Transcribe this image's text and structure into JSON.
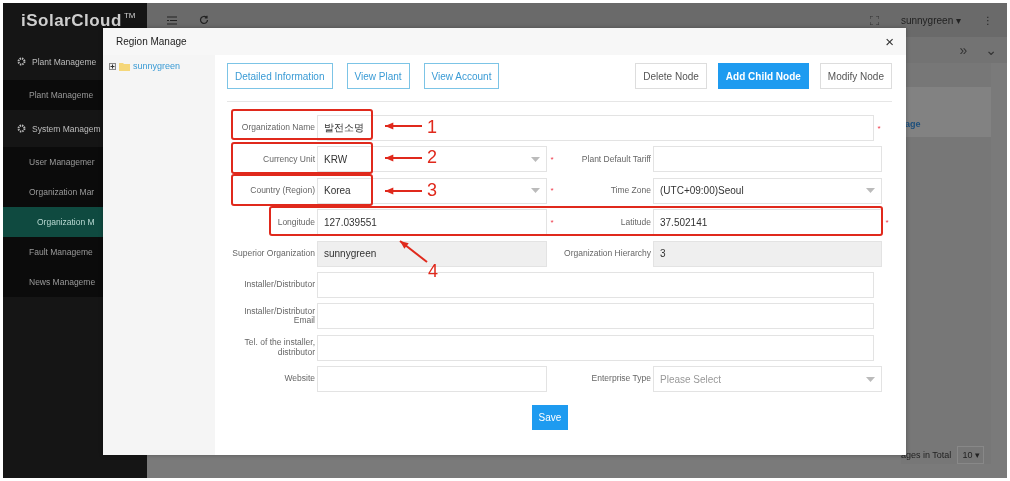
{
  "app": {
    "logo": "iSolarCloud",
    "logo_mark": "TM",
    "user": "sunnygreen ▾",
    "more": "⋮",
    "tabs_more": "»",
    "tabs_menu": "⌄"
  },
  "sidebar": {
    "items": [
      {
        "label": "Plant Manageme",
        "kind": "group",
        "selected": false
      },
      {
        "label": "Plant Manageme",
        "kind": "item",
        "selected": false
      },
      {
        "label": "System Managem",
        "kind": "group",
        "selected": false
      },
      {
        "label": "User Managemer",
        "kind": "item",
        "selected": false
      },
      {
        "label": "Organization Mar",
        "kind": "item",
        "selected": false
      },
      {
        "label": "Organization M",
        "kind": "subitem",
        "selected": true
      },
      {
        "label": "Fault Manageme",
        "kind": "item",
        "selected": false
      },
      {
        "label": "News Manageme",
        "kind": "item",
        "selected": false
      }
    ]
  },
  "background": {
    "link": "age",
    "pager_text": "ages in Total",
    "page_size": "10 ▾"
  },
  "dialog": {
    "title": "Region Manage",
    "close": "×",
    "tree": [
      {
        "label": "sunnygreen",
        "expanded": false
      }
    ],
    "actions_left": [
      {
        "label": "Detailed Information"
      },
      {
        "label": "View Plant"
      },
      {
        "label": "View Account"
      }
    ],
    "actions_right": [
      {
        "label": "Delete Node",
        "primary": false
      },
      {
        "label": "Add Child Node",
        "primary": true
      },
      {
        "label": "Modify Node",
        "primary": false
      }
    ],
    "required_mark": "*",
    "rows": [
      [
        {
          "label": "Organization Name",
          "kind": "text",
          "value": "발전소명",
          "required": true
        }
      ],
      [
        {
          "label": "Currency Unit",
          "kind": "select",
          "value": "KRW",
          "required": true
        },
        {
          "label": "Plant Default Tariff",
          "kind": "text",
          "required": false
        }
      ],
      [
        {
          "label": "Country (Region)",
          "kind": "select",
          "value": "Korea",
          "required": true
        },
        {
          "label": "Time Zone",
          "kind": "select",
          "value": "(UTC+09:00)Seoul",
          "required": false
        }
      ],
      [
        {
          "label": "Longitude",
          "kind": "text",
          "value": "127.039551",
          "required": true
        },
        {
          "label": "Latitude",
          "kind": "text",
          "value": "37.502141",
          "required": true
        }
      ],
      [
        {
          "label": "Superior Organization",
          "kind": "readonly",
          "value": "sunnygreen",
          "required": false
        },
        {
          "label": "Organization Hierarchy",
          "kind": "readonly",
          "value": "3",
          "required": false
        }
      ],
      [
        {
          "label": "Installer/Distributor",
          "kind": "text",
          "required": false
        }
      ],
      [
        {
          "label": "Installer/Distributor Email",
          "kind": "text",
          "required": false
        }
      ],
      [
        {
          "label": "Tel. of the installer, distributor",
          "kind": "text",
          "required": false
        }
      ],
      [
        {
          "label": "Website",
          "kind": "text",
          "required": false
        },
        {
          "label": "Enterprise Type",
          "kind": "select",
          "placeholder": "Please Select",
          "required": false
        }
      ]
    ],
    "save": "Save"
  },
  "annotations": [
    {
      "number": "1"
    },
    {
      "number": "2"
    },
    {
      "number": "3"
    },
    {
      "number": "4"
    }
  ]
}
